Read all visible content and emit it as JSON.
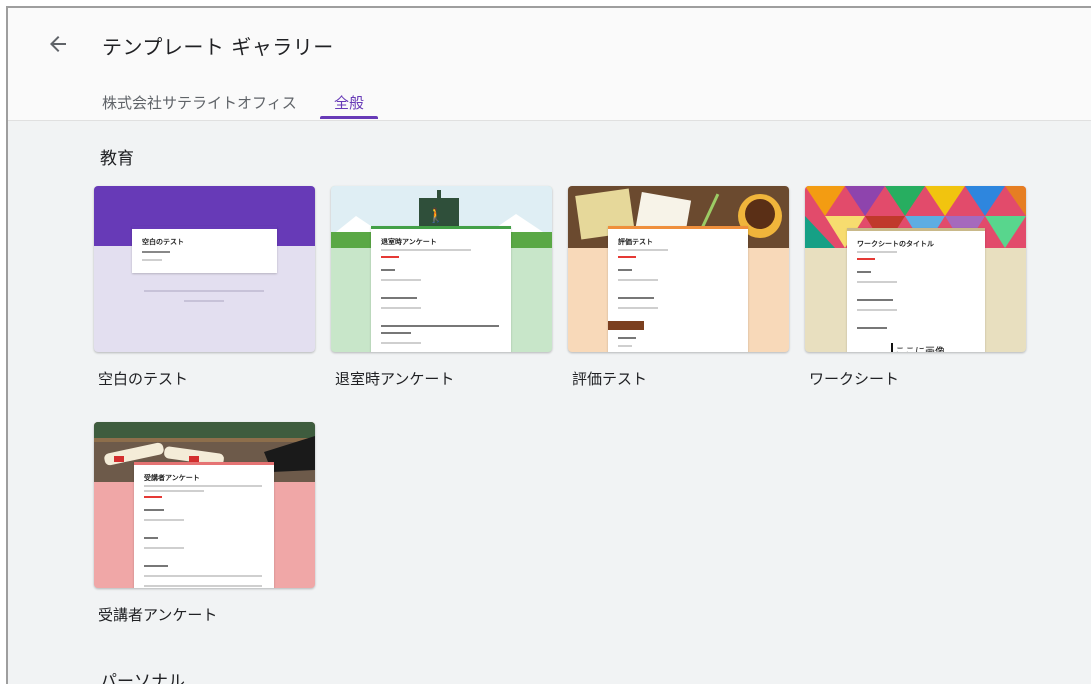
{
  "header": {
    "back_icon": "arrow-left-icon",
    "title": "テンプレート ギャラリー",
    "tabs": [
      {
        "label": "株式会社サテライトオフィス",
        "active": false
      },
      {
        "label": "全般",
        "active": true
      }
    ]
  },
  "colors": {
    "accent": "#673ab7",
    "background": "#f1f3f4"
  },
  "sections": [
    {
      "title": "教育",
      "templates": [
        {
          "label": "空白のテスト",
          "form_title": "空白のテスト",
          "theme": "#673ab7"
        },
        {
          "label": "退室時アンケート",
          "form_title": "退室時アンケート",
          "theme": "#43a047"
        },
        {
          "label": "評価テスト",
          "form_title": "評価テスト",
          "theme": "#ef8f3c"
        },
        {
          "label": "ワークシート",
          "form_title": "ワークシートのタイトル",
          "theme": "#c9b98a",
          "overlay_text": "ここに画像"
        },
        {
          "label": "受講者アンケート",
          "form_title": "受講者アンケート",
          "theme": "#e57373"
        }
      ]
    },
    {
      "title": "パーソナル"
    }
  ]
}
